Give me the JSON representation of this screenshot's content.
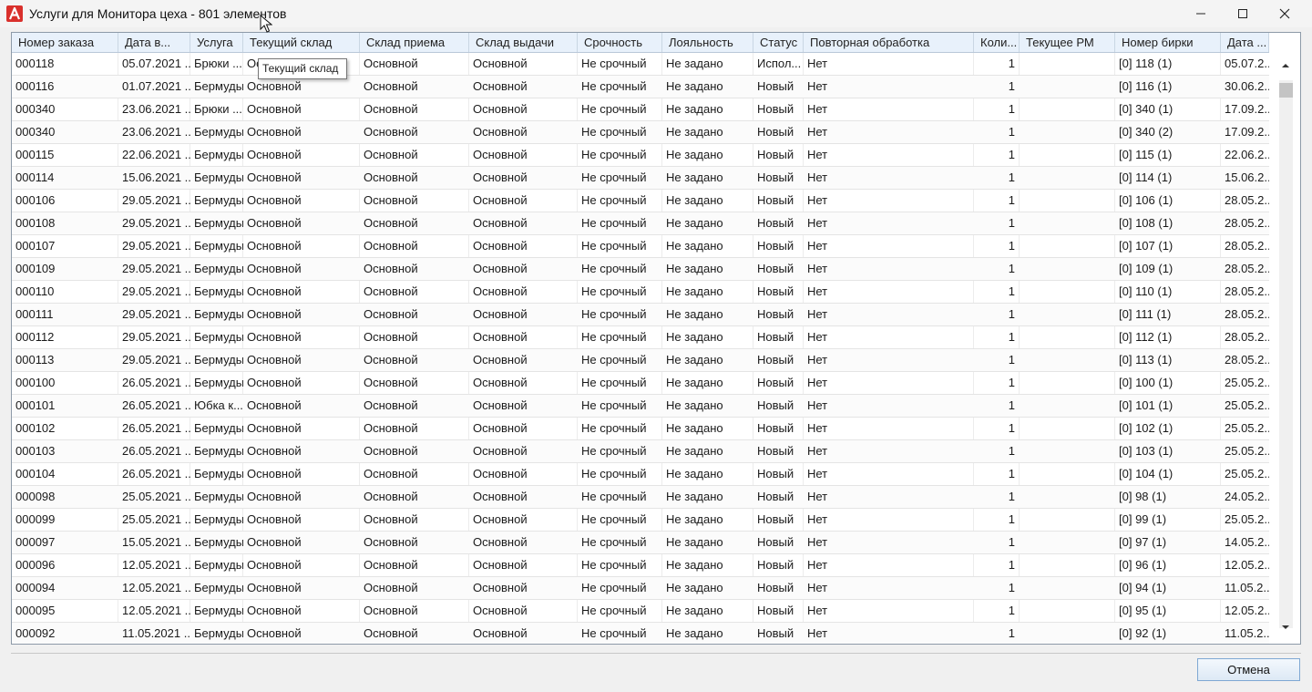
{
  "window": {
    "title": "Услуги для Монитора цеха - 801 элементов",
    "icon": "app-logo-icon",
    "accent_color": "#d9302c"
  },
  "columns": [
    "Номер заказа",
    "Дата в...",
    "Услуга",
    "Текущий склад",
    "Склад приема",
    "Склад выдачи",
    "Срочность",
    "Лояльность",
    "Статус",
    "Повторная обработка",
    "Коли...",
    "Текущее РМ",
    "Номер бирки",
    "Дата ..."
  ],
  "tooltip": "Текущий склад",
  "rows": [
    [
      "000118",
      "05.07.2021 ...",
      "Брюки ...",
      "Ос",
      "Основной",
      "Основной",
      "Не срочный",
      "Не задано",
      "Испол...",
      "Нет",
      "1",
      "",
      "[0] 118 (1)",
      "05.07.2..."
    ],
    [
      "000116",
      "01.07.2021 ...",
      "Бермуды",
      "Основной",
      "Основной",
      "Основной",
      "Не срочный",
      "Не задано",
      "Новый",
      "Нет",
      "1",
      "",
      "[0] 116 (1)",
      "30.06.2..."
    ],
    [
      "000340",
      "23.06.2021 ...",
      "Брюки ...",
      "Основной",
      "Основной",
      "Основной",
      "Не срочный",
      "Не задано",
      "Новый",
      "Нет",
      "1",
      "",
      "[0] 340 (1)",
      "17.09.2..."
    ],
    [
      "000340",
      "23.06.2021 ...",
      "Бермуды",
      "Основной",
      "Основной",
      "Основной",
      "Не срочный",
      "Не задано",
      "Новый",
      "Нет",
      "1",
      "",
      "[0] 340 (2)",
      "17.09.2..."
    ],
    [
      "000115",
      "22.06.2021 ...",
      "Бермуды",
      "Основной",
      "Основной",
      "Основной",
      "Не срочный",
      "Не задано",
      "Новый",
      "Нет",
      "1",
      "",
      "[0] 115 (1)",
      "22.06.2..."
    ],
    [
      "000114",
      "15.06.2021 ...",
      "Бермуды",
      "Основной",
      "Основной",
      "Основной",
      "Не срочный",
      "Не задано",
      "Новый",
      "Нет",
      "1",
      "",
      "[0] 114 (1)",
      "15.06.2..."
    ],
    [
      "000106",
      "29.05.2021 ...",
      "Бермуды",
      "Основной",
      "Основной",
      "Основной",
      "Не срочный",
      "Не задано",
      "Новый",
      "Нет",
      "1",
      "",
      "[0] 106 (1)",
      "28.05.2..."
    ],
    [
      "000108",
      "29.05.2021 ...",
      "Бермуды",
      "Основной",
      "Основной",
      "Основной",
      "Не срочный",
      "Не задано",
      "Новый",
      "Нет",
      "1",
      "",
      "[0] 108 (1)",
      "28.05.2..."
    ],
    [
      "000107",
      "29.05.2021 ...",
      "Бермуды",
      "Основной",
      "Основной",
      "Основной",
      "Не срочный",
      "Не задано",
      "Новый",
      "Нет",
      "1",
      "",
      "[0] 107 (1)",
      "28.05.2..."
    ],
    [
      "000109",
      "29.05.2021 ...",
      "Бермуды",
      "Основной",
      "Основной",
      "Основной",
      "Не срочный",
      "Не задано",
      "Новый",
      "Нет",
      "1",
      "",
      "[0] 109 (1)",
      "28.05.2..."
    ],
    [
      "000110",
      "29.05.2021 ...",
      "Бермуды",
      "Основной",
      "Основной",
      "Основной",
      "Не срочный",
      "Не задано",
      "Новый",
      "Нет",
      "1",
      "",
      "[0] 110 (1)",
      "28.05.2..."
    ],
    [
      "000111",
      "29.05.2021 ...",
      "Бермуды",
      "Основной",
      "Основной",
      "Основной",
      "Не срочный",
      "Не задано",
      "Новый",
      "Нет",
      "1",
      "",
      "[0] 111 (1)",
      "28.05.2..."
    ],
    [
      "000112",
      "29.05.2021 ...",
      "Бермуды",
      "Основной",
      "Основной",
      "Основной",
      "Не срочный",
      "Не задано",
      "Новый",
      "Нет",
      "1",
      "",
      "[0] 112 (1)",
      "28.05.2..."
    ],
    [
      "000113",
      "29.05.2021 ...",
      "Бермуды",
      "Основной",
      "Основной",
      "Основной",
      "Не срочный",
      "Не задано",
      "Новый",
      "Нет",
      "1",
      "",
      "[0] 113 (1)",
      "28.05.2..."
    ],
    [
      "000100",
      "26.05.2021 ...",
      "Бермуды",
      "Основной",
      "Основной",
      "Основной",
      "Не срочный",
      "Не задано",
      "Новый",
      "Нет",
      "1",
      "",
      "[0] 100 (1)",
      "25.05.2..."
    ],
    [
      "000101",
      "26.05.2021 ...",
      "Юбка к...",
      "Основной",
      "Основной",
      "Основной",
      "Не срочный",
      "Не задано",
      "Новый",
      "Нет",
      "1",
      "",
      "[0] 101 (1)",
      "25.05.2..."
    ],
    [
      "000102",
      "26.05.2021 ...",
      "Бермуды",
      "Основной",
      "Основной",
      "Основной",
      "Не срочный",
      "Не задано",
      "Новый",
      "Нет",
      "1",
      "",
      "[0] 102 (1)",
      "25.05.2..."
    ],
    [
      "000103",
      "26.05.2021 ...",
      "Бермуды",
      "Основной",
      "Основной",
      "Основной",
      "Не срочный",
      "Не задано",
      "Новый",
      "Нет",
      "1",
      "",
      "[0] 103 (1)",
      "25.05.2..."
    ],
    [
      "000104",
      "26.05.2021 ...",
      "Бермуды",
      "Основной",
      "Основной",
      "Основной",
      "Не срочный",
      "Не задано",
      "Новый",
      "Нет",
      "1",
      "",
      "[0] 104 (1)",
      "25.05.2..."
    ],
    [
      "000098",
      "25.05.2021 ...",
      "Бермуды",
      "Основной",
      "Основной",
      "Основной",
      "Не срочный",
      "Не задано",
      "Новый",
      "Нет",
      "1",
      "",
      "[0] 98 (1)",
      "24.05.2..."
    ],
    [
      "000099",
      "25.05.2021 ...",
      "Бермуды",
      "Основной",
      "Основной",
      "Основной",
      "Не срочный",
      "Не задано",
      "Новый",
      "Нет",
      "1",
      "",
      "[0] 99 (1)",
      "25.05.2..."
    ],
    [
      "000097",
      "15.05.2021 ...",
      "Бермуды",
      "Основной",
      "Основной",
      "Основной",
      "Не срочный",
      "Не задано",
      "Новый",
      "Нет",
      "1",
      "",
      "[0] 97 (1)",
      "14.05.2..."
    ],
    [
      "000096",
      "12.05.2021 ...",
      "Бермуды",
      "Основной",
      "Основной",
      "Основной",
      "Не срочный",
      "Не задано",
      "Новый",
      "Нет",
      "1",
      "",
      "[0] 96 (1)",
      "12.05.2..."
    ],
    [
      "000094",
      "12.05.2021 ...",
      "Бермуды",
      "Основной",
      "Основной",
      "Основной",
      "Не срочный",
      "Не задано",
      "Новый",
      "Нет",
      "1",
      "",
      "[0] 94 (1)",
      "11.05.2..."
    ],
    [
      "000095",
      "12.05.2021 ...",
      "Бермуды",
      "Основной",
      "Основной",
      "Основной",
      "Не срочный",
      "Не задано",
      "Новый",
      "Нет",
      "1",
      "",
      "[0] 95 (1)",
      "12.05.2..."
    ],
    [
      "000092",
      "11.05.2021 ...",
      "Бермуды",
      "Основной",
      "Основной",
      "Основной",
      "Не срочный",
      "Не задано",
      "Новый",
      "Нет",
      "1",
      "",
      "[0] 92 (1)",
      "11.05.2..."
    ]
  ],
  "scrollbar": {
    "position_fraction": 0.0
  },
  "footer": {
    "cancel_label": "Отмена"
  }
}
